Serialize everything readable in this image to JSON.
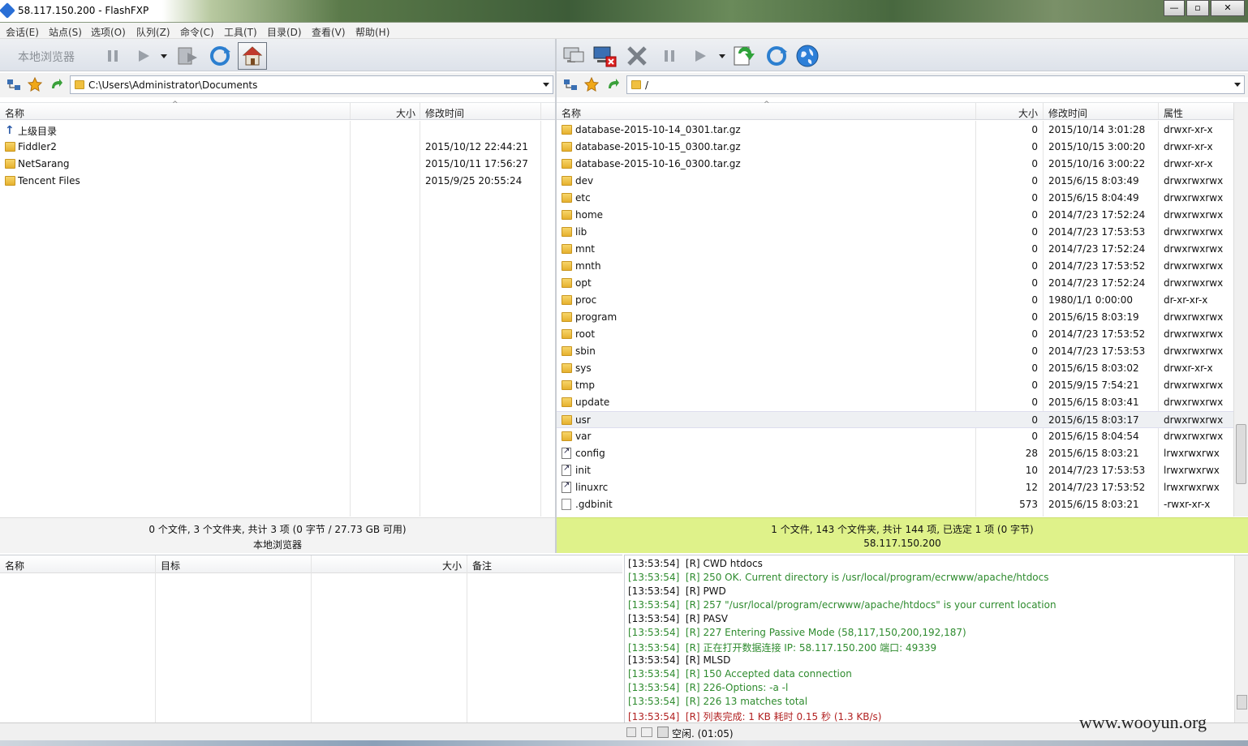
{
  "window": {
    "title": "58.117.150.200 - FlashFXP"
  },
  "menu": [
    "会话(E)",
    "站点(S)",
    "选项(O)",
    "队列(Z)",
    "命令(C)",
    "工具(T)",
    "目录(D)",
    "查看(V)",
    "帮助(H)"
  ],
  "left": {
    "toolbar_label": "本地浏览器",
    "path": "C:\\Users\\Administrator\\Documents",
    "columns": {
      "name": "名称",
      "size": "大小",
      "modified": "修改时间"
    },
    "rows": [
      {
        "name": "上级目录",
        "size": "",
        "modified": "",
        "type": "up"
      },
      {
        "name": "Fiddler2",
        "size": "",
        "modified": "2015/10/12 22:44:21",
        "type": "folder"
      },
      {
        "name": "NetSarang",
        "size": "",
        "modified": "2015/10/11 17:56:27",
        "type": "folder"
      },
      {
        "name": "Tencent Files",
        "size": "",
        "modified": "2015/9/25 20:55:24",
        "type": "folder"
      }
    ],
    "status": "0 个文件, 3 个文件夹, 共计 3 项 (0 字节 / 27.73 GB 可用)",
    "status2": "本地浏览器"
  },
  "right": {
    "path": "/",
    "columns": {
      "name": "名称",
      "size": "大小",
      "modified": "修改时间",
      "attr": "属性"
    },
    "rows": [
      {
        "name": "database-2015-10-14_0301.tar.gz",
        "size": "0",
        "modified": "2015/10/14 3:01:28",
        "attr": "drwxr-xr-x",
        "type": "folder"
      },
      {
        "name": "database-2015-10-15_0300.tar.gz",
        "size": "0",
        "modified": "2015/10/15 3:00:20",
        "attr": "drwxr-xr-x",
        "type": "folder"
      },
      {
        "name": "database-2015-10-16_0300.tar.gz",
        "size": "0",
        "modified": "2015/10/16 3:00:22",
        "attr": "drwxr-xr-x",
        "type": "folder"
      },
      {
        "name": "dev",
        "size": "0",
        "modified": "2015/6/15 8:03:49",
        "attr": "drwxrwxrwx",
        "type": "folder"
      },
      {
        "name": "etc",
        "size": "0",
        "modified": "2015/6/15 8:04:49",
        "attr": "drwxrwxrwx",
        "type": "folder"
      },
      {
        "name": "home",
        "size": "0",
        "modified": "2014/7/23 17:52:24",
        "attr": "drwxrwxrwx",
        "type": "folder"
      },
      {
        "name": "lib",
        "size": "0",
        "modified": "2014/7/23 17:53:53",
        "attr": "drwxrwxrwx",
        "type": "folder"
      },
      {
        "name": "mnt",
        "size": "0",
        "modified": "2014/7/23 17:52:24",
        "attr": "drwxrwxrwx",
        "type": "folder"
      },
      {
        "name": "mnth",
        "size": "0",
        "modified": "2014/7/23 17:53:52",
        "attr": "drwxrwxrwx",
        "type": "folder"
      },
      {
        "name": "opt",
        "size": "0",
        "modified": "2014/7/23 17:52:24",
        "attr": "drwxrwxrwx",
        "type": "folder"
      },
      {
        "name": "proc",
        "size": "0",
        "modified": "1980/1/1 0:00:00",
        "attr": "dr-xr-xr-x",
        "type": "folder"
      },
      {
        "name": "program",
        "size": "0",
        "modified": "2015/6/15 8:03:19",
        "attr": "drwxrwxrwx",
        "type": "folder"
      },
      {
        "name": "root",
        "size": "0",
        "modified": "2014/7/23 17:53:52",
        "attr": "drwxrwxrwx",
        "type": "folder"
      },
      {
        "name": "sbin",
        "size": "0",
        "modified": "2014/7/23 17:53:53",
        "attr": "drwxrwxrwx",
        "type": "folder"
      },
      {
        "name": "sys",
        "size": "0",
        "modified": "2015/6/15 8:03:02",
        "attr": "drwxr-xr-x",
        "type": "folder"
      },
      {
        "name": "tmp",
        "size": "0",
        "modified": "2015/9/15 7:54:21",
        "attr": "drwxrwxrwx",
        "type": "folder"
      },
      {
        "name": "update",
        "size": "0",
        "modified": "2015/6/15 8:03:41",
        "attr": "drwxrwxrwx",
        "type": "folder"
      },
      {
        "name": "usr",
        "size": "0",
        "modified": "2015/6/15 8:03:17",
        "attr": "drwxrwxrwx",
        "type": "folder",
        "selected": true
      },
      {
        "name": "var",
        "size": "0",
        "modified": "2015/6/15 8:04:54",
        "attr": "drwxrwxrwx",
        "type": "folder"
      },
      {
        "name": "config",
        "size": "28",
        "modified": "2015/6/15 8:03:21",
        "attr": "lrwxrwxrwx",
        "type": "link"
      },
      {
        "name": "init",
        "size": "10",
        "modified": "2014/7/23 17:53:53",
        "attr": "lrwxrwxrwx",
        "type": "link"
      },
      {
        "name": "linuxrc",
        "size": "12",
        "modified": "2014/7/23 17:53:52",
        "attr": "lrwxrwxrwx",
        "type": "link"
      },
      {
        "name": ".gdbinit",
        "size": "573",
        "modified": "2015/6/15 8:03:21",
        "attr": "-rwxr-xr-x",
        "type": "file"
      }
    ],
    "status": "1 个文件, 143 个文件夹, 共计 144 项, 已选定 1 项 (0 字节)",
    "status2": "58.117.150.200"
  },
  "queue": {
    "columns": {
      "name": "名称",
      "target": "目标",
      "size": "大小",
      "note": "备注"
    }
  },
  "log": [
    {
      "time": "[13:53:54]",
      "tag": "[R]",
      "text": "CWD htdocs",
      "color": "#111111"
    },
    {
      "time": "[13:53:54]",
      "tag": "[R]",
      "text": "250 OK. Current directory is /usr/local/program/ecrwww/apache/htdocs",
      "color": "#2e8b2e"
    },
    {
      "time": "[13:53:54]",
      "tag": "[R]",
      "text": "PWD",
      "color": "#111111"
    },
    {
      "time": "[13:53:54]",
      "tag": "[R]",
      "text": "257 \"/usr/local/program/ecrwww/apache/htdocs\" is your current location",
      "color": "#2e8b2e"
    },
    {
      "time": "[13:53:54]",
      "tag": "[R]",
      "text": "PASV",
      "color": "#111111"
    },
    {
      "time": "[13:53:54]",
      "tag": "[R]",
      "text": "227 Entering Passive Mode (58,117,150,200,192,187)",
      "color": "#2e8b2e"
    },
    {
      "time": "[13:53:54]",
      "tag": "[R]",
      "text": "正在打开数据连接 IP: 58.117.150.200 端口: 49339",
      "color": "#2e8b2e"
    },
    {
      "time": "[13:53:54]",
      "tag": "[R]",
      "text": "MLSD",
      "color": "#111111"
    },
    {
      "time": "[13:53:54]",
      "tag": "[R]",
      "text": "150 Accepted data connection",
      "color": "#2e8b2e"
    },
    {
      "time": "[13:53:54]",
      "tag": "[R]",
      "text": "226-Options: -a -l",
      "color": "#2e8b2e"
    },
    {
      "time": "[13:53:54]",
      "tag": "[R]",
      "text": "226 13 matches total",
      "color": "#2e8b2e"
    },
    {
      "time": "[13:53:54]",
      "tag": "[R]",
      "text": "列表完成: 1 KB 耗时 0.15 秒 (1.3 KB/s)",
      "color": "#b22222"
    }
  ],
  "bottom_status": "空闲. (01:05)",
  "watermark": "www.wooyun.org"
}
